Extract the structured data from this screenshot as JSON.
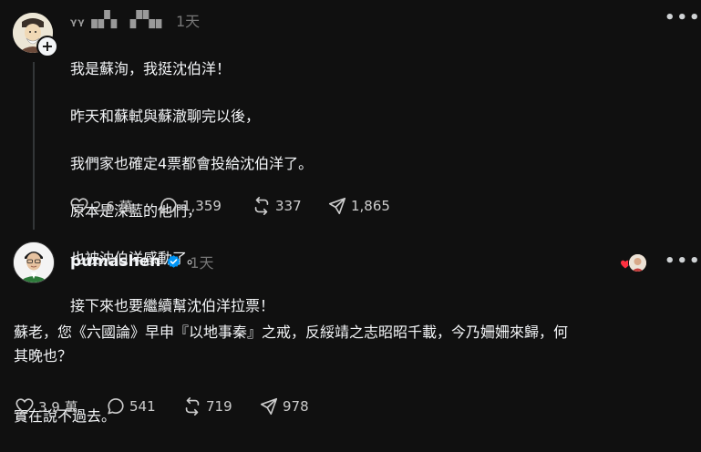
{
  "post1": {
    "username": "ᵧᵧ▗▞▖ ▞▚▖",
    "time": "1天",
    "lines": [
      "我是蘇洵，我挺沈伯洋！",
      "昨天和蘇軾與蘇澈聊完以後，",
      "我們家也確定4票都會投給沈伯洋了。",
      "原本是深藍的他們，",
      "也被沈伯洋感動了。",
      "接下來也要繼續幫沈伯洋拉票！"
    ],
    "likes": "2.6 萬",
    "comments": "1,359",
    "reposts": "337",
    "shares": "1,865",
    "more_icon": "more-dots-icon"
  },
  "post2": {
    "username": "pumashen",
    "time": "1天",
    "paragraph1": "蘇老，您《六國論》早申『以地事秦』之戒，反綏靖之志昭昭千載，今乃姍姍來歸，何\n其晚也？",
    "paragraph2": "實在說不過去。",
    "likes": "3.9 萬",
    "comments": "541",
    "reposts": "719",
    "shares": "978"
  },
  "colors": {
    "background": "#101010",
    "text": "#f3f5f7",
    "muted": "#777777",
    "verified": "#0095f6",
    "heart": "#ff3040"
  }
}
